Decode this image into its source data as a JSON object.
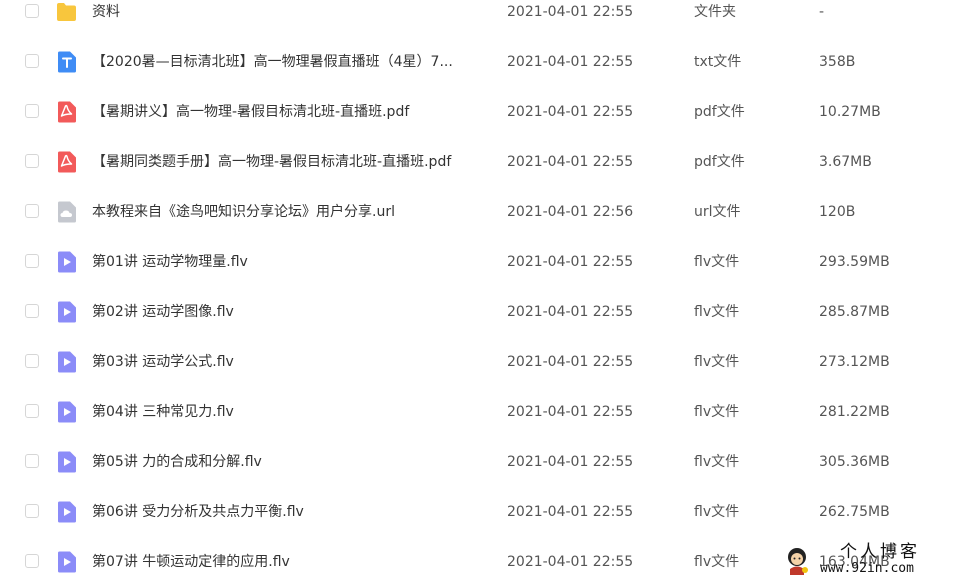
{
  "colors": {
    "folder": "#f8c63d",
    "txt": "#3f8cf5",
    "pdf": "#f25a5a",
    "url": "#c5c8cf",
    "flv": "#8b8cf8"
  },
  "files": [
    {
      "icon": "folder-icon",
      "kind": "folder",
      "name": "资料",
      "date": "2021-04-01 22:55",
      "type": "文件夹",
      "size": "-"
    },
    {
      "icon": "txt-file-icon",
      "kind": "txt",
      "name": "【2020暑—目标清北班】高一物理暑假直播班（4星）7...",
      "date": "2021-04-01 22:55",
      "type": "txt文件",
      "size": "358B"
    },
    {
      "icon": "pdf-file-icon",
      "kind": "pdf",
      "name": "【暑期讲义】高一物理-暑假目标清北班-直播班.pdf",
      "date": "2021-04-01 22:55",
      "type": "pdf文件",
      "size": "10.27MB"
    },
    {
      "icon": "pdf-file-icon",
      "kind": "pdf",
      "name": "【暑期同类题手册】高一物理-暑假目标清北班-直播班.pdf",
      "date": "2021-04-01 22:55",
      "type": "pdf文件",
      "size": "3.67MB"
    },
    {
      "icon": "url-file-icon",
      "kind": "url",
      "name": "本教程来自《途鸟吧知识分享论坛》用户分享.url",
      "date": "2021-04-01 22:56",
      "type": "url文件",
      "size": "120B"
    },
    {
      "icon": "video-file-icon",
      "kind": "flv",
      "name": "第01讲 运动学物理量.flv",
      "date": "2021-04-01 22:55",
      "type": "flv文件",
      "size": "293.59MB"
    },
    {
      "icon": "video-file-icon",
      "kind": "flv",
      "name": "第02讲 运动学图像.flv",
      "date": "2021-04-01 22:55",
      "type": "flv文件",
      "size": "285.87MB"
    },
    {
      "icon": "video-file-icon",
      "kind": "flv",
      "name": "第03讲 运动学公式.flv",
      "date": "2021-04-01 22:55",
      "type": "flv文件",
      "size": "273.12MB"
    },
    {
      "icon": "video-file-icon",
      "kind": "flv",
      "name": "第04讲 三种常见力.flv",
      "date": "2021-04-01 22:55",
      "type": "flv文件",
      "size": "281.22MB"
    },
    {
      "icon": "video-file-icon",
      "kind": "flv",
      "name": "第05讲 力的合成和分解.flv",
      "date": "2021-04-01 22:55",
      "type": "flv文件",
      "size": "305.36MB"
    },
    {
      "icon": "video-file-icon",
      "kind": "flv",
      "name": "第06讲 受力分析及共点力平衡.flv",
      "date": "2021-04-01 22:55",
      "type": "flv文件",
      "size": "262.75MB"
    },
    {
      "icon": "video-file-icon",
      "kind": "flv",
      "name": "第07讲 牛顿运动定律的应用.flv",
      "date": "2021-04-01 22:55",
      "type": "flv文件",
      "size": "163.04MB"
    }
  ],
  "watermark": {
    "title": "个人博客",
    "url": "www.92in.com"
  }
}
